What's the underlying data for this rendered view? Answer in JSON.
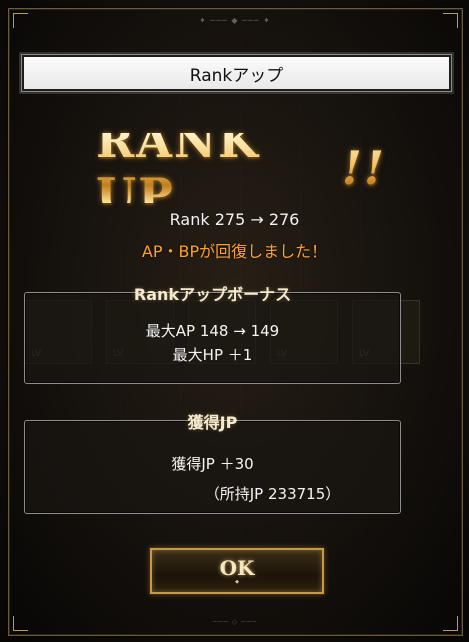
{
  "dialog": {
    "title": "Rankアップ",
    "rank_up_text": "RANK UP",
    "rank_up_marks": "!!",
    "rank_line": "Rank 275 → 276",
    "recovery_text": "AP・BPが回復しました！"
  },
  "rank_bonus": {
    "heading": "Rankアップボーナス",
    "max_ap": "最大AP 148 → 149",
    "max_hp": "最大HP ＋1"
  },
  "jp": {
    "heading": "獲得JP",
    "gained": "獲得JP ＋30",
    "owned": "（所持JP 233715）"
  },
  "ok_button": {
    "label": "OK"
  },
  "colors": {
    "accent_gold": "#c69a45",
    "recovery_orange": "#ffa12a"
  }
}
